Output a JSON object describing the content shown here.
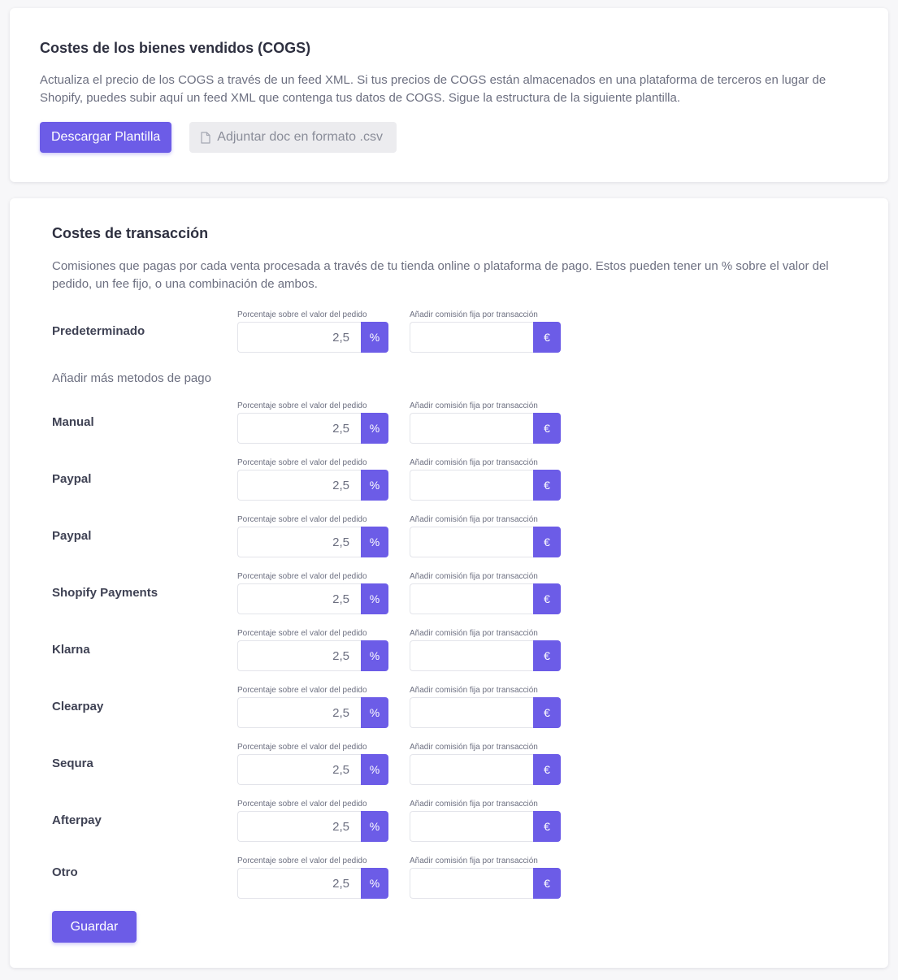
{
  "cogs": {
    "title": "Costes de los bienes vendidos (COGS)",
    "description": "Actualiza el precio de los COGS a través de un feed XML. Si tus precios de COGS están almacenados en una plataforma de terceros en lugar de Shopify, puedes subir aquí un feed XML que contenga tus datos de COGS. Sigue la estructura de la siguiente plantilla.",
    "download_label": "Descargar Plantilla",
    "attach_label": "Adjuntar doc en formato .csv"
  },
  "transaction": {
    "title": "Costes de transacción",
    "description": "Comisiones que pagas por cada venta procesada a través de tu tienda online o plataforma de pago. Estos pueden tener un % sobre el valor del pedido, un fee fijo, o una combinación de ambos.",
    "percent_field_label": "Porcentaje sobre el valor del pedido",
    "fee_field_label": "Añadir comisión fija por transacción",
    "percent_symbol": "%",
    "currency_symbol": "€",
    "default_method": {
      "name": "Predeterminado",
      "percent": "2,5",
      "fee": ""
    },
    "add_more_label": "Añadir más metodos de pago",
    "methods": [
      {
        "name": "Manual",
        "percent": "2,5",
        "fee": ""
      },
      {
        "name": "Paypal",
        "percent": "2,5",
        "fee": ""
      },
      {
        "name": "Paypal",
        "percent": "2,5",
        "fee": ""
      },
      {
        "name": "Shopify Payments",
        "percent": "2,5",
        "fee": ""
      },
      {
        "name": "Klarna",
        "percent": "2,5",
        "fee": ""
      },
      {
        "name": "Clearpay",
        "percent": "2,5",
        "fee": ""
      },
      {
        "name": "Sequra",
        "percent": "2,5",
        "fee": ""
      },
      {
        "name": "Afterpay",
        "percent": "2,5",
        "fee": ""
      },
      {
        "name": "Otro",
        "percent": "2,5",
        "fee": ""
      }
    ],
    "save_label": "Guardar"
  },
  "colors": {
    "accent": "#6c5ce7",
    "attach_bg": "#ececef"
  }
}
